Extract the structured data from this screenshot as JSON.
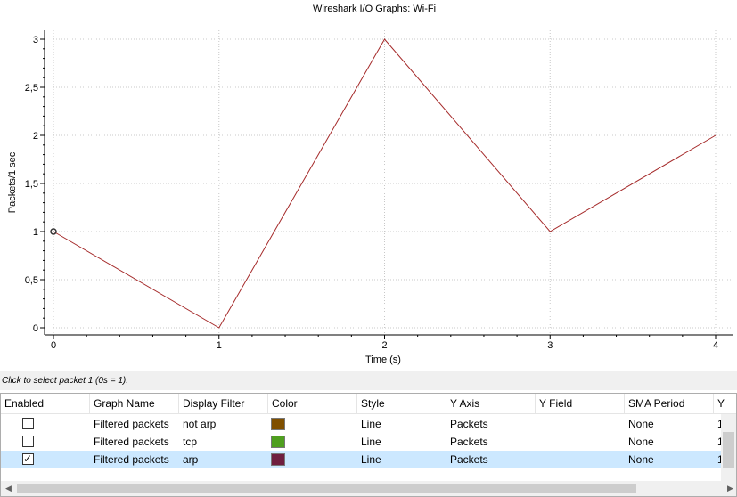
{
  "chart_data": {
    "type": "line",
    "title": "Wireshark I/O Graphs: Wi-Fi",
    "xlabel": "Time (s)",
    "ylabel": "Packets/1 sec",
    "x": [
      0,
      1,
      2,
      3,
      4
    ],
    "xlim": [
      0,
      4
    ],
    "ylim": [
      0,
      3
    ],
    "x_ticks": [
      "0",
      "1",
      "2",
      "3",
      "4"
    ],
    "y_ticks": [
      "0",
      "0,5",
      "1",
      "1,5",
      "2",
      "2,5",
      "3"
    ],
    "grid": true,
    "series": [
      {
        "values": [
          1,
          0,
          3,
          1,
          2
        ],
        "color": "#a52a2a"
      }
    ],
    "selected_point": {
      "x": 0,
      "y": 1
    }
  },
  "status": {
    "hint": "Click to select packet 1 (0s = 1)."
  },
  "table": {
    "columns": [
      "Enabled",
      "Graph Name",
      "Display Filter",
      "Color",
      "Style",
      "Y Axis",
      "Y Field",
      "SMA Period",
      "Y"
    ],
    "rows": [
      {
        "enabled": false,
        "name": "Filtered packets",
        "filter": "not arp",
        "color": "#7f4f00",
        "style": "Line",
        "y_axis": "Packets",
        "y_field": "",
        "sma": "None",
        "extra": "1"
      },
      {
        "enabled": false,
        "name": "Filtered packets",
        "filter": "tcp",
        "color": "#4f9f1f",
        "style": "Line",
        "y_axis": "Packets",
        "y_field": "",
        "sma": "None",
        "extra": "1"
      },
      {
        "enabled": true,
        "name": "Filtered packets",
        "filter": "arp",
        "color": "#6f1f3f",
        "style": "Line",
        "y_axis": "Packets",
        "y_field": "",
        "sma": "None",
        "extra": "1"
      }
    ]
  }
}
